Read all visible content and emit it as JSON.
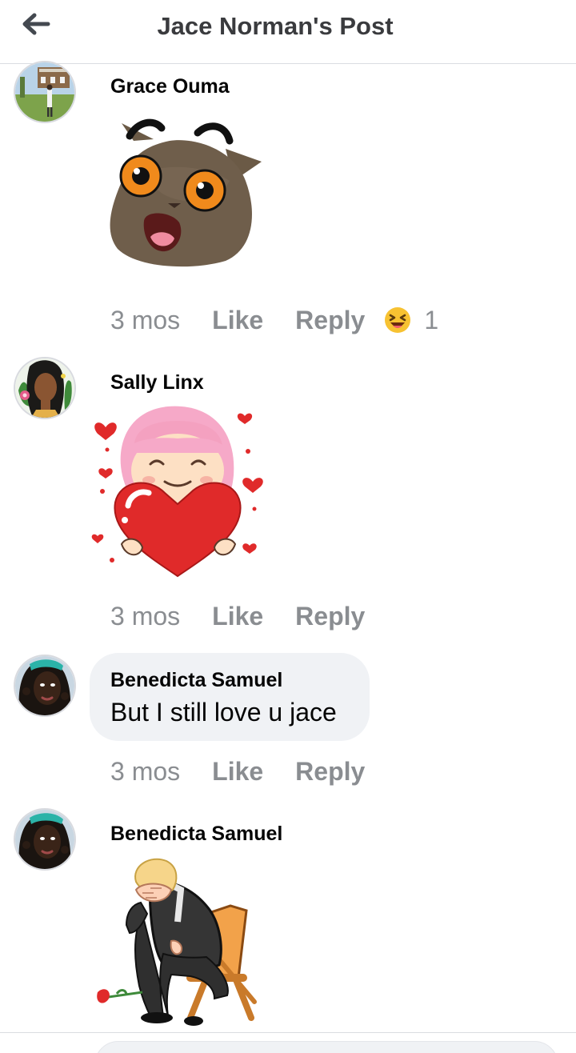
{
  "header": {
    "title": "Jace Norman's Post",
    "back_icon": "arrow-left-icon"
  },
  "comments": [
    {
      "author": "Grace Ouma",
      "sticker": "surprised-cat-sticker",
      "time": "3 mos",
      "like_label": "Like",
      "reply_label": "Reply",
      "reaction_icon": "laughing-emoji-icon",
      "reaction_count": "1"
    },
    {
      "author": "Sally Linx",
      "sticker": "girl-holding-heart-sticker",
      "time": "3 mos",
      "like_label": "Like",
      "reply_label": "Reply"
    },
    {
      "author": "Benedicta Samuel",
      "text": "But I still love u jace",
      "time": "3 mos",
      "like_label": "Like",
      "reply_label": "Reply"
    },
    {
      "author": "Benedicta Samuel",
      "sticker": "sad-man-on-chair-sticker"
    }
  ],
  "composer": {
    "placeholder": ""
  },
  "colors": {
    "meta_text": "#8a8d91",
    "bubble_bg": "#f0f2f5",
    "header_text": "#3a3b3e",
    "heart_red": "#e02a2a",
    "cat_eye_orange": "#f08a1c"
  }
}
